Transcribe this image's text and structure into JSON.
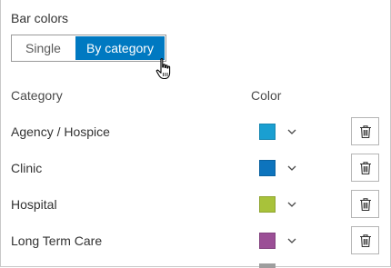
{
  "bar_colors": {
    "title": "Bar colors",
    "options": [
      "Single",
      "By category"
    ],
    "selected": "By category"
  },
  "table": {
    "headers": {
      "category": "Category",
      "color": "Color"
    },
    "rows": [
      {
        "label": "Agency / Hospice",
        "color": "#1a9fd1"
      },
      {
        "label": "Clinic",
        "color": "#0d74bd"
      },
      {
        "label": "Hospital",
        "color": "#a8c23a"
      },
      {
        "label": "Long Term Care",
        "color": "#9b4f96"
      }
    ]
  },
  "icons": {
    "dropdown": "chevron-down-icon",
    "delete": "trash-icon",
    "cursor": "hand-pointer-icon"
  }
}
